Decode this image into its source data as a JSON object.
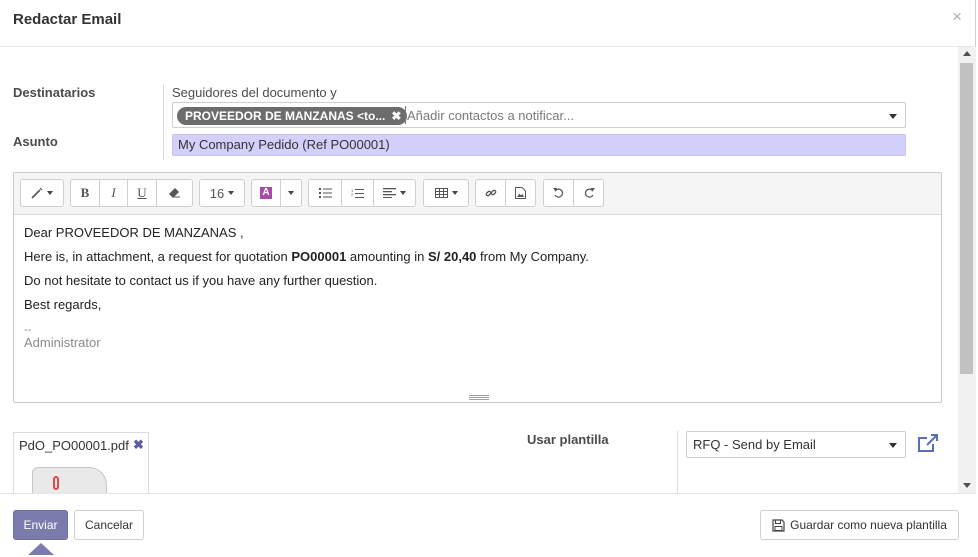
{
  "dialog": {
    "title": "Redactar Email",
    "close_label": "×"
  },
  "form": {
    "recipients_label": "Destinatarios",
    "followers_text": "Seguidores del documento y",
    "recipient_tag": "PROVEEDOR DE MANZANAS <to...",
    "recipients_placeholder": "Añadir contactos a notificar...",
    "subject_label": "Asunto",
    "subject_value": "My Company Pedido (Ref PO00001)"
  },
  "toolbar": {
    "font_size": "16",
    "items": [
      "style",
      "bold",
      "italic",
      "underline",
      "eraser",
      "font-size",
      "text-color",
      "color-dropdown",
      "unordered-list",
      "ordered-list",
      "paragraph-align",
      "table",
      "link",
      "image",
      "undo",
      "redo"
    ]
  },
  "body": {
    "greeting": "Dear PROVEEDOR DE MANZANAS ,",
    "line1_before": "Here is, in attachment, a request for quotation ",
    "line1_ref": "PO00001",
    "line1_middle": " amounting in ",
    "line1_amount": "S/ 20,40",
    "line1_after": " from My Company.",
    "line2": "Do not hesitate to contact us if you have any further question.",
    "closing": "Best regards,",
    "signature_dashes": "--",
    "signature_name": "Administrator"
  },
  "attachment": {
    "filename": "PdO_PO00001.pdf",
    "remove_label": "✖"
  },
  "template": {
    "label": "Usar plantilla",
    "selected": "RFQ - Send by Email"
  },
  "footer": {
    "send_label": "Enviar",
    "cancel_label": "Cancelar",
    "save_template_label": "Guardar como nueva plantilla"
  },
  "colors": {
    "primary": "#7c7bad",
    "subject_bg": "#d3d1fb",
    "tag_bg": "#6c6c6c"
  }
}
